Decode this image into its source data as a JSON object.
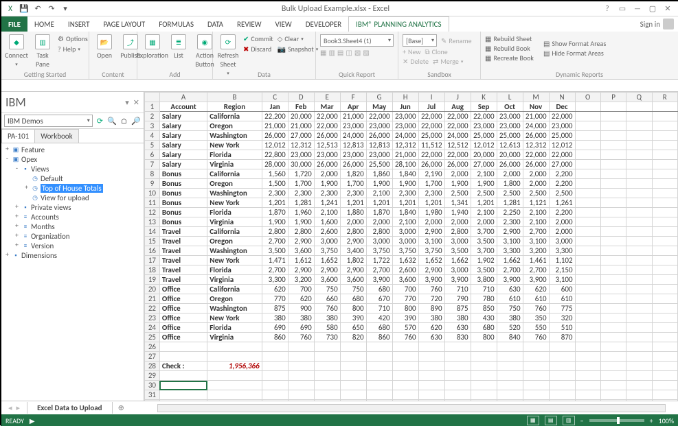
{
  "title": "Bulk Upload Example.xlsx - Excel",
  "signin": "Sign in",
  "tabs": [
    "FILE",
    "HOME",
    "INSERT",
    "PAGE LAYOUT",
    "FORMULAS",
    "DATA",
    "REVIEW",
    "VIEW",
    "DEVELOPER",
    "IBM® Planning Analytics"
  ],
  "ribbon": {
    "getting_started": {
      "label": "Getting Started",
      "connect": "Connect",
      "task_pane": "Task\nPane",
      "options": "Options",
      "help": "Help"
    },
    "content": {
      "label": "Content",
      "open": "Open",
      "publish": "Publish"
    },
    "add": {
      "label": "Add",
      "exploration": "Exploration",
      "list": "List",
      "action_button": "Action\nButton"
    },
    "data": {
      "label": "Data",
      "refresh": "Refresh\nSheet",
      "commit": "Commit",
      "discard": "Discard",
      "clear": "Clear",
      "snapshot": "Snapshot"
    },
    "quick_report": {
      "label": "Quick Report",
      "sel1": "Book3.Sheet4 (1)"
    },
    "sandbox": {
      "label": "Sandbox",
      "sel": "[Base]",
      "rename": "Rename",
      "new": "New",
      "clone": "Clone",
      "delete": "Delete",
      "merge": "Merge"
    },
    "dynamic": {
      "label": "Dynamic Reports",
      "rebuild_sheet": "Rebuild Sheet",
      "rebuild_book": "Rebuild Book",
      "recreate_book": "Recreate Book",
      "show_fmt": "Show Format Areas",
      "hide_fmt": "Hide Format Areas"
    }
  },
  "pane": {
    "title": "IBM",
    "server": "IBM Demos",
    "tabs": [
      "PA-101",
      "Workbook"
    ],
    "tree": [
      {
        "d": 0,
        "tw": "+",
        "ic": "cube",
        "lbl": "Feature"
      },
      {
        "d": 0,
        "tw": "-",
        "ic": "cube",
        "lbl": "Opex"
      },
      {
        "d": 1,
        "tw": "-",
        "ic": "folder",
        "lbl": "Views"
      },
      {
        "d": 2,
        "tw": "",
        "ic": "view",
        "lbl": "Default"
      },
      {
        "d": 2,
        "tw": "+",
        "ic": "view",
        "lbl": "Top of House Totals",
        "sel": true
      },
      {
        "d": 2,
        "tw": "",
        "ic": "view",
        "lbl": "View for upload"
      },
      {
        "d": 1,
        "tw": "+",
        "ic": "folder",
        "lbl": "Private views"
      },
      {
        "d": 1,
        "tw": "+",
        "ic": "dim",
        "lbl": "Accounts"
      },
      {
        "d": 1,
        "tw": "+",
        "ic": "dim",
        "lbl": "Months"
      },
      {
        "d": 1,
        "tw": "+",
        "ic": "dim",
        "lbl": "Organization"
      },
      {
        "d": 1,
        "tw": "+",
        "ic": "dim",
        "lbl": "Version"
      },
      {
        "d": 0,
        "tw": "+",
        "ic": "folder",
        "lbl": "Dimensions"
      }
    ]
  },
  "columns": [
    "",
    "A",
    "B",
    "C",
    "D",
    "E",
    "F",
    "G",
    "H",
    "I",
    "J",
    "K",
    "L",
    "M",
    "N",
    "O",
    "P",
    "Q",
    "R"
  ],
  "header_row": [
    "Account",
    "Region",
    "Jan",
    "Feb",
    "Mar",
    "Apr",
    "May",
    "Jun",
    "Jul",
    "Aug",
    "Sep",
    "Oct",
    "Nov",
    "Dec"
  ],
  "rows": [
    [
      "Salary",
      "California",
      "22,200",
      "20,000",
      "22,000",
      "21,000",
      "22,000",
      "23,000",
      "22,000",
      "22,000",
      "22,000",
      "23,000",
      "21,000",
      "22,000"
    ],
    [
      "Salary",
      "Oregon",
      "21,000",
      "21,000",
      "22,000",
      "23,000",
      "23,000",
      "23,000",
      "22,000",
      "22,000",
      "23,000",
      "23,000",
      "24,000",
      "23,000"
    ],
    [
      "Salary",
      "Washington",
      "26,000",
      "27,000",
      "26,000",
      "24,000",
      "26,000",
      "24,000",
      "25,000",
      "24,000",
      "25,000",
      "25,000",
      "26,000",
      "25,000"
    ],
    [
      "Salary",
      "New York",
      "12,012",
      "12,312",
      "12,513",
      "12,813",
      "12,813",
      "12,312",
      "11,512",
      "12,512",
      "12,012",
      "12,613",
      "12,312",
      "12,012"
    ],
    [
      "Salary",
      "Florida",
      "22,800",
      "23,000",
      "23,000",
      "23,000",
      "23,000",
      "21,000",
      "22,000",
      "22,000",
      "20,000",
      "20,000",
      "22,000",
      "22,000"
    ],
    [
      "Salary",
      "Virginia",
      "28,000",
      "30,000",
      "26,000",
      "26,000",
      "25,500",
      "28,100",
      "26,000",
      "26,000",
      "27,000",
      "26,000",
      "26,000",
      "27,000"
    ],
    [
      "Bonus",
      "California",
      "1,560",
      "1,720",
      "2,000",
      "1,820",
      "1,860",
      "1,840",
      "2,190",
      "2,000",
      "2,100",
      "2,000",
      "2,000",
      "2,200"
    ],
    [
      "Bonus",
      "Oregon",
      "1,500",
      "1,700",
      "1,900",
      "1,700",
      "1,900",
      "1,900",
      "1,700",
      "1,900",
      "1,900",
      "1,800",
      "2,000",
      "2,200"
    ],
    [
      "Bonus",
      "Washington",
      "2,300",
      "2,300",
      "2,300",
      "2,300",
      "2,100",
      "2,300",
      "2,300",
      "2,500",
      "2,500",
      "2,500",
      "2,500",
      "2,500"
    ],
    [
      "Bonus",
      "New York",
      "1,201",
      "1,281",
      "1,241",
      "1,201",
      "1,201",
      "1,201",
      "1,201",
      "1,341",
      "1,201",
      "1,281",
      "1,121",
      "1,261"
    ],
    [
      "Bonus",
      "Florida",
      "1,870",
      "1,960",
      "2,100",
      "1,880",
      "1,870",
      "1,840",
      "1,980",
      "1,940",
      "2,100",
      "2,250",
      "2,100",
      "2,200"
    ],
    [
      "Bonus",
      "Virginia",
      "1,900",
      "1,900",
      "1,600",
      "2,000",
      "2,000",
      "2,100",
      "2,000",
      "2,000",
      "2,000",
      "2,300",
      "2,100",
      "2,000"
    ],
    [
      "Travel",
      "California",
      "2,800",
      "2,800",
      "2,600",
      "2,800",
      "2,800",
      "3,000",
      "2,900",
      "2,800",
      "3,700",
      "2,900",
      "2,700",
      "2,000"
    ],
    [
      "Travel",
      "Oregon",
      "2,700",
      "2,900",
      "3,000",
      "2,900",
      "3,000",
      "3,000",
      "3,100",
      "3,000",
      "3,500",
      "3,100",
      "3,100",
      "3,000"
    ],
    [
      "Travel",
      "Washington",
      "3,500",
      "3,600",
      "3,750",
      "3,400",
      "3,750",
      "3,750",
      "3,750",
      "3,500",
      "3,700",
      "3,300",
      "3,200",
      "3,300"
    ],
    [
      "Travel",
      "New York",
      "1,471",
      "1,612",
      "1,652",
      "1,802",
      "1,722",
      "1,632",
      "1,652",
      "1,662",
      "1,902",
      "1,662",
      "1,461",
      "1,102"
    ],
    [
      "Travel",
      "Florida",
      "2,700",
      "2,900",
      "2,900",
      "2,900",
      "2,700",
      "2,600",
      "2,900",
      "3,000",
      "3,500",
      "2,700",
      "2,700",
      "2,150"
    ],
    [
      "Travel",
      "Virginia",
      "3,300",
      "3,200",
      "3,600",
      "3,600",
      "3,900",
      "3,600",
      "3,900",
      "3,900",
      "3,800",
      "3,900",
      "3,900",
      "3,100"
    ],
    [
      "Office",
      "California",
      "620",
      "700",
      "750",
      "750",
      "680",
      "700",
      "760",
      "710",
      "710",
      "630",
      "620",
      "600"
    ],
    [
      "Office",
      "Oregon",
      "770",
      "620",
      "660",
      "680",
      "670",
      "770",
      "720",
      "790",
      "780",
      "610",
      "610",
      "610"
    ],
    [
      "Office",
      "Washington",
      "875",
      "900",
      "760",
      "800",
      "710",
      "800",
      "890",
      "875",
      "850",
      "750",
      "760",
      "775"
    ],
    [
      "Office",
      "New York",
      "380",
      "380",
      "380",
      "390",
      "420",
      "390",
      "380",
      "380",
      "430",
      "380",
      "350",
      "320"
    ],
    [
      "Office",
      "Florida",
      "690",
      "690",
      "580",
      "650",
      "680",
      "570",
      "620",
      "630",
      "680",
      "520",
      "550",
      "510"
    ],
    [
      "Office",
      "Virginia",
      "860",
      "760",
      "730",
      "820",
      "860",
      "760",
      "630",
      "830",
      "800",
      "840",
      "760",
      "870"
    ]
  ],
  "check": {
    "label": "Check :",
    "value": "1,956,366"
  },
  "sheet_tab": "Excel Data to Upload",
  "status": {
    "ready": "READY",
    "zoom": "100%"
  }
}
